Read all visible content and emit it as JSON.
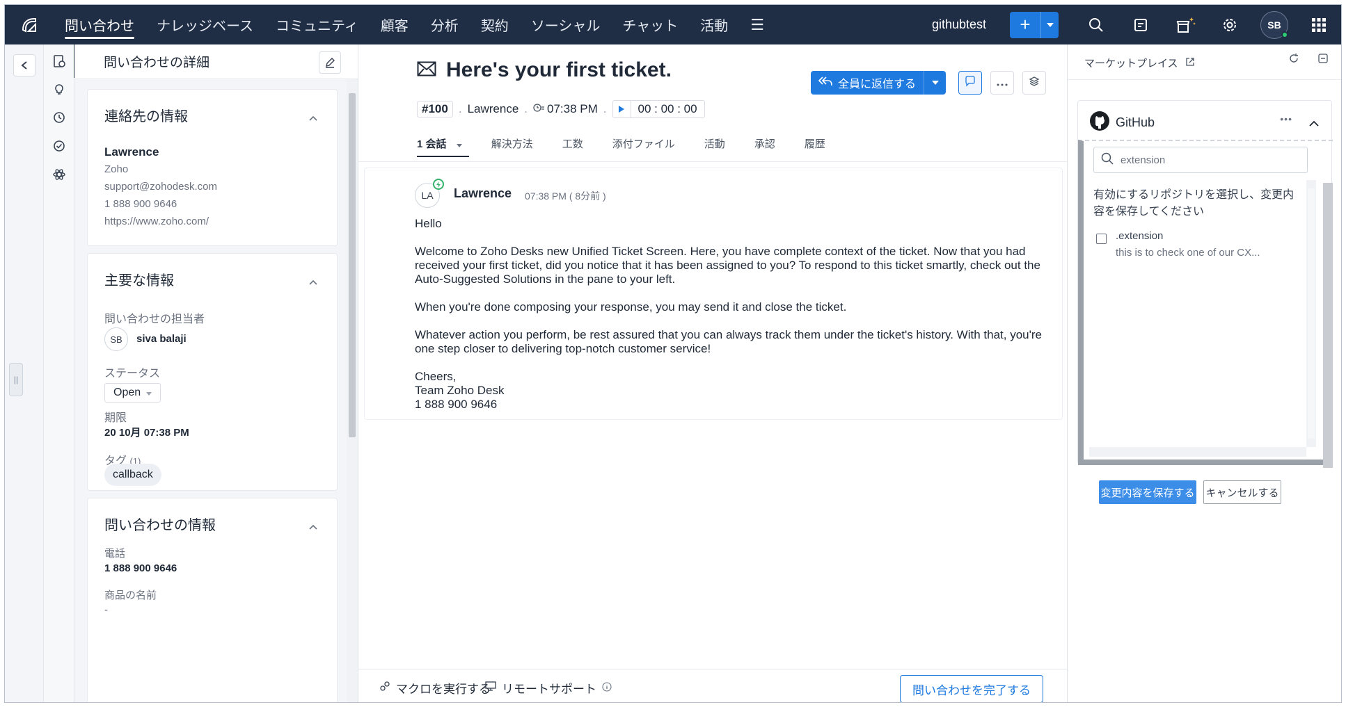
{
  "topnav": {
    "tabs": [
      {
        "label": "問い合わせ",
        "active": true
      },
      {
        "label": "ナレッジベース"
      },
      {
        "label": "コミュニティ"
      },
      {
        "label": "顧客"
      },
      {
        "label": "分析"
      },
      {
        "label": "契約"
      },
      {
        "label": "ソーシャル"
      },
      {
        "label": "チャット"
      },
      {
        "label": "活動"
      }
    ],
    "more_glyph": "☰",
    "org_name": "githubtest",
    "plus_glyph": "+",
    "avatar_initials": "SB",
    "accent_color": "#1f7ae0",
    "nav_bg": "#1f2d45",
    "icons": [
      "search-icon",
      "notes-icon",
      "marketplace-icon",
      "gear-icon",
      "apps-grid-icon"
    ]
  },
  "details": {
    "header_title": "問い合わせの詳細",
    "contact": {
      "title": "連絡先の情報",
      "name": "Lawrence",
      "account": "Zoho",
      "email": "support@zohodesk.com",
      "phone": "1 888 900 9646",
      "website": "https://www.zoho.com/"
    },
    "key_info": {
      "title": "主要な情報",
      "owner_label": "問い合わせの担当者",
      "owner_initials": "SB",
      "owner_name": "siva balaji",
      "status_label": "ステータス",
      "status_value": "Open",
      "due_label": "期限",
      "due_value": "20 10月 07:38 PM",
      "tags_label": "タグ",
      "tags_count": "(1)",
      "tag_value": "callback"
    },
    "ticket_info": {
      "title": "問い合わせの情報",
      "phone_label": "電話",
      "phone_value": "1 888 900 9646",
      "product_label": "商品の名前",
      "product_value": "-"
    }
  },
  "ticket": {
    "subject": "Here's your first ticket.",
    "id": "#100",
    "contact": "Lawrence",
    "time": "07:38 PM",
    "timer": "00 : 00 : 00",
    "reply_all": "全員に返信する",
    "tabs": [
      {
        "label": "1 会話",
        "active": true
      },
      {
        "label": "解決方法"
      },
      {
        "label": "工数"
      },
      {
        "label": "添付ファイル"
      },
      {
        "label": "活動"
      },
      {
        "label": "承認"
      },
      {
        "label": "履歴"
      }
    ],
    "thread": {
      "initials": "LA",
      "from": "Lawrence",
      "when": "07:38 PM ( 8分前 )",
      "paragraphs": [
        "Hello",
        "Welcome to Zoho Desks new Unified Ticket Screen. Here, you have complete context of the ticket. Now that you had received your first ticket, did you notice that it has been assigned to you? To respond to this ticket smartly, check out the Auto-Suggested Solutions in the pane to your left.",
        "When you're done composing your response, you may send it and close the ticket.",
        "Whatever action you perform, be rest assured that you can always track them under the ticket's history. With that, you're one step closer to delivering top-notch customer service!",
        "Cheers,\nTeam Zoho Desk\n1 888 900 9646"
      ]
    },
    "bottom": {
      "macro": "マクロを実行する",
      "remote": "リモートサポート",
      "close": "問い合わせを完了する"
    }
  },
  "marketplace": {
    "title": "マーケットプレイス",
    "widget_title": "GitHub",
    "search_value": "extension",
    "instruction": "有効にするリポジトリを選択し、変更内容を保存してください",
    "repo_name": ".extension",
    "repo_desc": "this is to check one of our CX...",
    "save": "変更内容を保存する",
    "cancel": "キャンセルする"
  }
}
